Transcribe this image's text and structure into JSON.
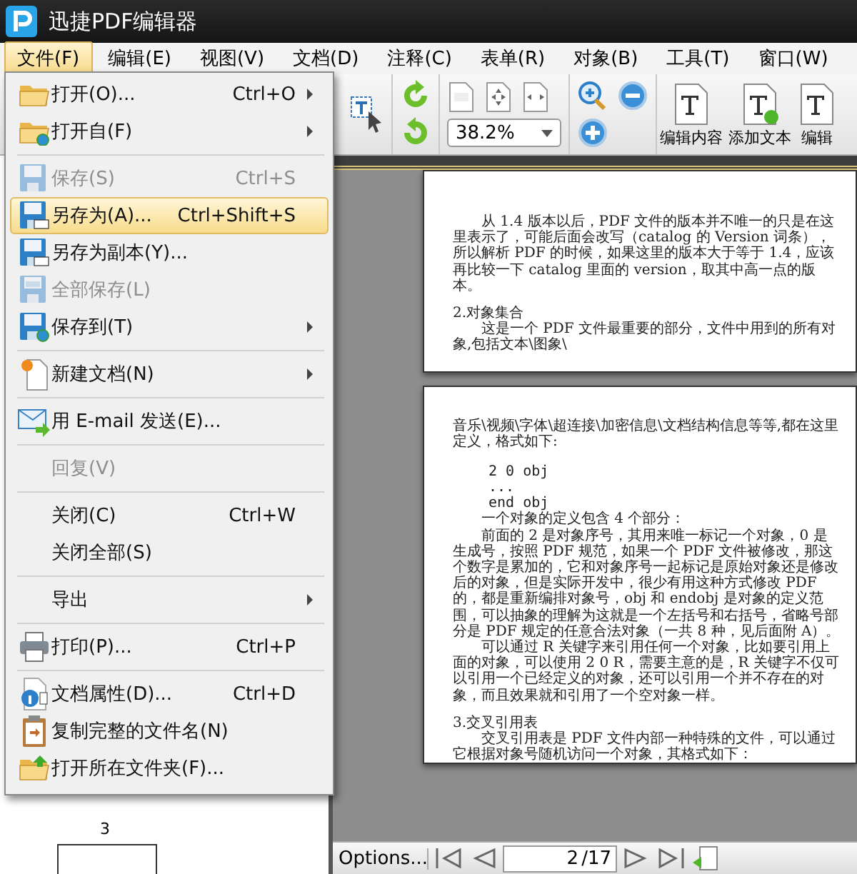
{
  "window": {
    "title": "迅捷PDF编辑器"
  },
  "menu_bar": [
    {
      "label": "文件(F)",
      "selected": true
    },
    {
      "label": "编辑(E)",
      "selected": false
    },
    {
      "label": "视图(V)",
      "selected": false
    },
    {
      "label": "文档(D)",
      "selected": false
    },
    {
      "label": "注释(C)",
      "selected": false
    },
    {
      "label": "表单(R)",
      "selected": false
    },
    {
      "label": "对象(B)",
      "selected": false
    },
    {
      "label": "工具(T)",
      "selected": false
    },
    {
      "label": "窗口(W)",
      "selected": false
    }
  ],
  "file_menu": [
    {
      "kind": "item",
      "label": "打开(O)...",
      "shortcut": "Ctrl+O",
      "submenu": true,
      "disabled": false,
      "selected": false
    },
    {
      "kind": "item",
      "label": "打开自(F)",
      "submenu": true,
      "disabled": false,
      "selected": false
    },
    {
      "kind": "separator"
    },
    {
      "kind": "item",
      "label": "保存(S)",
      "shortcut": "Ctrl+S",
      "submenu": false,
      "disabled": true,
      "selected": false
    },
    {
      "kind": "item",
      "label": "另存为(A)...",
      "shortcut": "Ctrl+Shift+S",
      "submenu": false,
      "disabled": false,
      "selected": true
    },
    {
      "kind": "item",
      "label": "另存为副本(Y)...",
      "submenu": false,
      "disabled": false,
      "selected": false
    },
    {
      "kind": "item",
      "label": "全部保存(L)",
      "submenu": false,
      "disabled": true,
      "selected": false
    },
    {
      "kind": "item",
      "label": "保存到(T)",
      "submenu": true,
      "disabled": false,
      "selected": false
    },
    {
      "kind": "separator"
    },
    {
      "kind": "item",
      "label": "新建文档(N)",
      "submenu": true,
      "disabled": false,
      "selected": false
    },
    {
      "kind": "separator"
    },
    {
      "kind": "item",
      "label": "用 E-mail 发送(E)...",
      "submenu": false,
      "disabled": false,
      "selected": false
    },
    {
      "kind": "separator"
    },
    {
      "kind": "item",
      "label": "回复(V)",
      "submenu": false,
      "disabled": true,
      "selected": false
    },
    {
      "kind": "separator"
    },
    {
      "kind": "item",
      "label": "关闭(C)",
      "shortcut": "Ctrl+W",
      "submenu": false,
      "disabled": false,
      "selected": false
    },
    {
      "kind": "item",
      "label": "关闭全部(S)",
      "submenu": false,
      "disabled": false,
      "selected": false
    },
    {
      "kind": "separator"
    },
    {
      "kind": "item",
      "label": "导出",
      "submenu": true,
      "disabled": false,
      "selected": false
    },
    {
      "kind": "separator"
    },
    {
      "kind": "item",
      "label": "打印(P)...",
      "shortcut": "Ctrl+P",
      "submenu": false,
      "disabled": false,
      "selected": false
    },
    {
      "kind": "separator"
    },
    {
      "kind": "item",
      "label": "文档属性(D)...",
      "shortcut": "Ctrl+D",
      "submenu": false,
      "disabled": false,
      "selected": false
    },
    {
      "kind": "item",
      "label": "复制完整的文件名(N)",
      "submenu": false,
      "disabled": false,
      "selected": false
    },
    {
      "kind": "item",
      "label": "打开所在文件夹(F)...",
      "submenu": false,
      "disabled": false,
      "selected": false
    }
  ],
  "toolbar": {
    "zoom": "38.2%",
    "buttons": [
      {
        "label": "编辑内容"
      },
      {
        "label": "添加文本"
      },
      {
        "label": "编辑"
      }
    ]
  },
  "thumbnails": {
    "page_label": "3"
  },
  "pages": [
    {
      "blocks": [
        {
          "kind": "para",
          "text": "从 1.4 版本以后，PDF 文件的版本并不唯一的只是在这里表示了，可能后面会改写（catalog 的 Version 词条），所以解析 PDF 的时候，如果这里的版本大于等于 1.4，应该再比较一下 catalog 里面的 version，取其中高一点的版本。"
        },
        {
          "kind": "heading",
          "text": "2.对象集合"
        },
        {
          "kind": "para",
          "text": "这是一个 PDF 文件最重要的部分，文件中用到的所有对象,包括文本\\图象\\"
        }
      ]
    },
    {
      "blocks": [
        {
          "kind": "cont",
          "text": "音乐\\视频\\字体\\超连接\\加密信息\\文档结构信息等等,都在这里定义，格式如下:"
        },
        {
          "kind": "code",
          "text": "2 0 obj"
        },
        {
          "kind": "code",
          "text": "..."
        },
        {
          "kind": "code",
          "text": "end obj"
        },
        {
          "kind": "para",
          "text": "一个对象的定义包含 4 个部分："
        },
        {
          "kind": "para",
          "text": "前面的 2 是对象序号，其用来唯一标记一个对象，0 是生成号，按照 PDF 规范，如果一个 PDF 文件被修改，那这个数字是累加的，它和对象序号一起标记是原始对象还是修改后的对象，但是实际开发中，很少有用这种方式修改 PDF 的，都是重新编排对象号，obj 和 endobj 是对象的定义范围，可以抽象的理解为这就是一个左括号和右括号，省略号部分是 PDF 规定的任意合法对象（一共 8 种，见后面附 A）。"
        },
        {
          "kind": "para",
          "text": "可以通过 R 关键字来引用任何一个对象，比如要引用上面的对象，可以使用 2 0 R，需要主意的是，R 关键字不仅可以引用一个已经定义的对象，还可以引用一个并不存在的对象，而且效果就和引用了一个空对象一样。"
        },
        {
          "kind": "heading",
          "text": "3.交叉引用表"
        },
        {
          "kind": "para",
          "text": "交叉引用表是 PDF 文件内部一种特殊的文件，可以通过它根据对象号随机访问一个对象，其格式如下："
        }
      ]
    }
  ],
  "status_bar": {
    "options": "Options...",
    "page": "2",
    "page_count": "/17"
  }
}
